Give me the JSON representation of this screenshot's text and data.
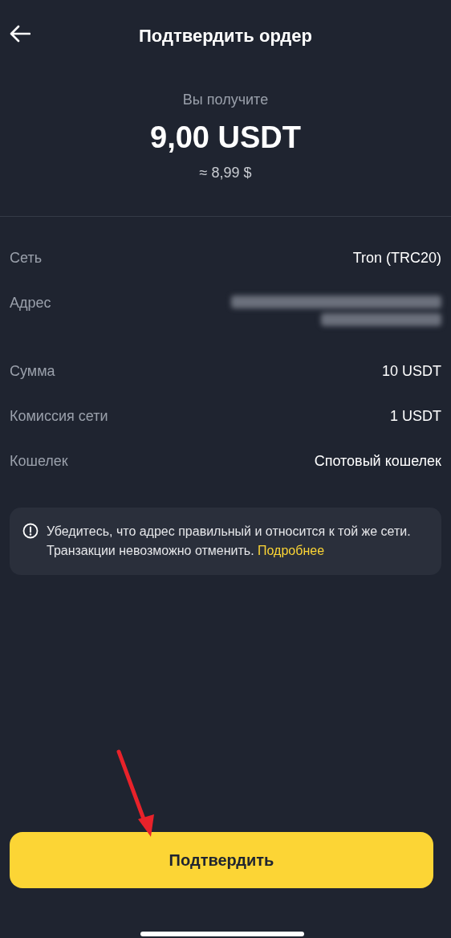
{
  "header": {
    "title": "Подтвердить ордер"
  },
  "summary": {
    "label": "Вы получите",
    "amount": "9,00 USDT",
    "approx": "≈ 8,99 $"
  },
  "details": [
    {
      "kind": "text",
      "label": "Сеть",
      "value": "Tron (TRC20)"
    },
    {
      "kind": "hidden",
      "label": "Адрес"
    },
    {
      "kind": "text",
      "label": "Сумма",
      "value": "10 USDT"
    },
    {
      "kind": "text",
      "label": "Комиссия сети",
      "value": "1 USDT"
    },
    {
      "kind": "text",
      "label": "Кошелек",
      "value": "Спотовый кошелек"
    }
  ],
  "notice": {
    "line1": "Убедитесь, что адрес правильный и относится к той же сети.",
    "line2": "Транзакции невозможно отменить.",
    "link": "Подробнее"
  },
  "confirm_button": {
    "label": "Подтвердить"
  }
}
